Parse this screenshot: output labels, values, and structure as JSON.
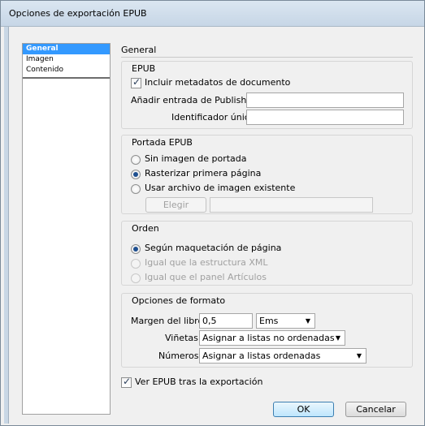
{
  "window": {
    "title": "Opciones de exportación EPUB"
  },
  "sidebar": {
    "items": [
      {
        "label": "General"
      },
      {
        "label": "Imagen"
      },
      {
        "label": "Contenido"
      }
    ]
  },
  "main": {
    "title": "General"
  },
  "epub": {
    "title": "EPUB",
    "include_metadata_label": "Incluir metadatos de documento",
    "include_metadata_checked": true,
    "publisher_label": "Añadir entrada de Publisher:",
    "publisher_value": "",
    "uid_label": "Identificador único:",
    "uid_value": ""
  },
  "cover": {
    "title": "Portada EPUB",
    "options": [
      {
        "label": "Sin imagen de portada",
        "selected": false
      },
      {
        "label": "Rasterizar primera página",
        "selected": true
      },
      {
        "label": "Usar archivo de imagen existente",
        "selected": false
      }
    ],
    "choose_label": "Elegir",
    "path_value": ""
  },
  "order": {
    "title": "Orden",
    "options": [
      {
        "label": "Según maquetación de página",
        "selected": true,
        "disabled": false
      },
      {
        "label": "Igual que la estructura XML",
        "selected": false,
        "disabled": true
      },
      {
        "label": "Igual que el panel Artículos",
        "selected": false,
        "disabled": true
      }
    ]
  },
  "format": {
    "title": "Opciones de formato",
    "margin_label": "Margen del libro:",
    "margin_value": "0,5",
    "margin_unit": "Ems",
    "bullets_label": "Viñetas:",
    "bullets_value": "Asignar a listas no ordenadas",
    "numbers_label": "Números:",
    "numbers_value": "Asignar a listas ordenadas"
  },
  "view_after": {
    "label": "Ver EPUB tras la exportación",
    "checked": true
  },
  "buttons": {
    "ok": "OK",
    "cancel": "Cancelar"
  }
}
